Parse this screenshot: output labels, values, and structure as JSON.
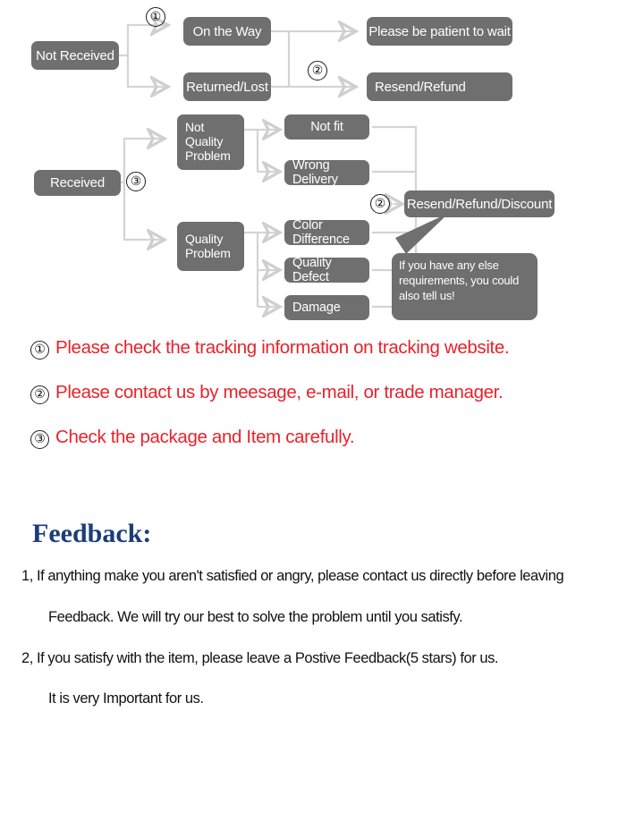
{
  "flowchart": {
    "nodes": [
      {
        "id": "not-received",
        "label": "Not Received"
      },
      {
        "id": "on-the-way",
        "label": "On the Way"
      },
      {
        "id": "returned-lost",
        "label": "Returned/Lost"
      },
      {
        "id": "please-be-patient",
        "label": "Please be patient to wait"
      },
      {
        "id": "resend-refund",
        "label": "Resend/Refund"
      },
      {
        "id": "received",
        "label": "Received"
      },
      {
        "id": "not-quality-problem",
        "label_lines": [
          "Not",
          "Quality",
          "Problem"
        ]
      },
      {
        "id": "quality-problem",
        "label_lines": [
          "Quality",
          "Problem"
        ]
      },
      {
        "id": "not-fit",
        "label": "Not fit"
      },
      {
        "id": "wrong-delivery",
        "label": "Wrong Delivery"
      },
      {
        "id": "color-difference",
        "label": "Color Difference"
      },
      {
        "id": "quality-defect",
        "label": "Quality Defect"
      },
      {
        "id": "damage",
        "label": "Damage"
      },
      {
        "id": "resend-refund-discount",
        "label": "Resend/Refund/Discount"
      }
    ],
    "markers": {
      "m1": "①",
      "m2_top": "②",
      "m3": "③",
      "m2_bottom": "②"
    },
    "bubble": {
      "line1": "If you have any else",
      "line2": "requirements, you could",
      "line3": "also tell us!"
    },
    "colors": {
      "node_fill": "#6f6f6f",
      "connector": "#d2d2d2",
      "node_text": "#ffffff"
    }
  },
  "notes": [
    {
      "num": "①",
      "text": "Please check the tracking information on tracking website."
    },
    {
      "num": "②",
      "text": "Please contact us by meesage, e-mail, or trade manager."
    },
    {
      "num": "③",
      "text": "Check the package and Item carefully."
    }
  ],
  "notes_color": "#e8222a",
  "feedback": {
    "title": "Feedback:",
    "title_color": "#1c3c7c",
    "line1": "1, If anything make you aren't satisfied or angry, please contact us directly before leaving",
    "line2": "Feedback. We will try our best to solve the problem until you satisfy.",
    "line3": "2, If you satisfy with the item, please leave a Postive Feedback(5 stars) for us.",
    "line4": "It is very Important for us."
  }
}
